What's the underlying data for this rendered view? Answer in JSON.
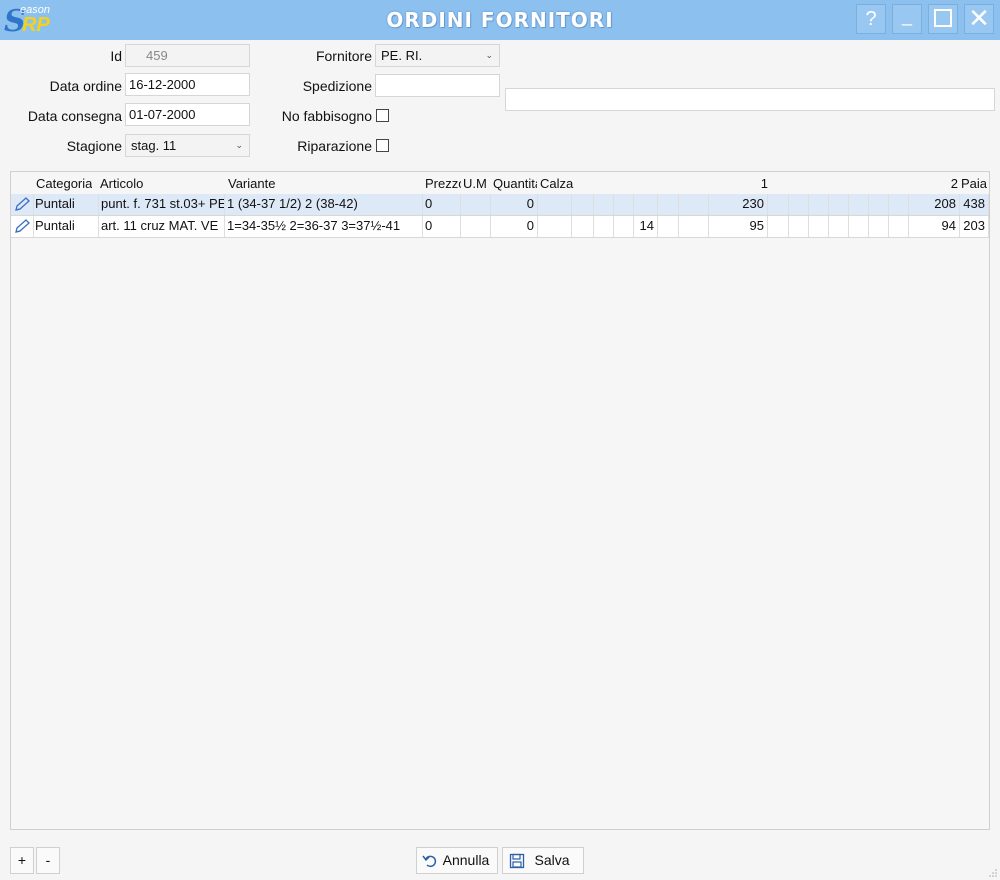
{
  "window": {
    "title": "ORDINI FORNITORI",
    "logo": {
      "s": "S",
      "eason": "eason",
      "rp": "RP"
    },
    "buttons": {
      "help": "?",
      "minimize": "_",
      "close": "✕"
    }
  },
  "form": {
    "id": {
      "label": "Id",
      "value": "459"
    },
    "data_ordine": {
      "label": "Data ordine",
      "value": "16-12-2000"
    },
    "data_consegna": {
      "label": "Data consegna",
      "value": "01-07-2000"
    },
    "stagione": {
      "label": "Stagione",
      "value": "stag. 11"
    },
    "fornitore": {
      "label": "Fornitore",
      "value": "PE. RI."
    },
    "spedizione": {
      "label": "Spedizione",
      "value": ""
    },
    "no_fabbisogno": {
      "label": "No fabbisogno",
      "checked": false
    },
    "riparazione": {
      "label": "Riparazione",
      "checked": false
    },
    "note": {
      "value": ""
    }
  },
  "grid": {
    "headers": {
      "categoria": "Categoria",
      "articolo": "Articolo",
      "variante": "Variante",
      "prezzo": "Prezzo",
      "um": "U.M",
      "quantita": "Quantità",
      "calza": "Calza",
      "s1": "1",
      "s2": "2",
      "paia": "Paia"
    },
    "rows": [
      {
        "categoria": "Puntali",
        "articolo": "punt. f. 731 st.03+ PE",
        "variante": "1 (34-37 1/2)   2 (38-42)",
        "prezzo": "0",
        "um": "",
        "quantita": "0",
        "calza": "",
        "c14": "",
        "s1": "230",
        "s2": "208",
        "paia": "438"
      },
      {
        "categoria": "Puntali",
        "articolo": "art. 11 cruz  MAT. VE",
        "variante": "1=34-35½  2=36-37 3=37½-41",
        "prezzo": "0",
        "um": "",
        "quantita": "0",
        "calza": "",
        "c14": "14",
        "s1": "95",
        "s2": "94",
        "paia": "203"
      }
    ]
  },
  "footer": {
    "add": "+",
    "remove": "-",
    "annulla": "Annulla",
    "salva": "Salva"
  },
  "colors": {
    "titlebar": "#8cc0ef",
    "selected_row": "#dde9f7"
  }
}
